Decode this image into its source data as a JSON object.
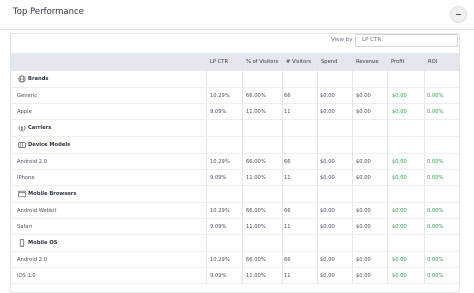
{
  "panel": {
    "title": "Top Performance"
  },
  "view_by": {
    "label": "View by",
    "value": "LP CTR"
  },
  "columns": [
    "LP CTR",
    "% of Visitors",
    "# Visitors",
    "Spend",
    "Revenue",
    "Profit",
    "ROI"
  ],
  "sections": [
    {
      "title": "Brands",
      "icon": "globe-icon",
      "rows": [
        {
          "name": "Generic",
          "cells": [
            "10.29%",
            "66.00%",
            "66",
            "$0.00",
            "$0.00",
            "$0.00",
            "0.00%"
          ]
        },
        {
          "name": "Apple",
          "cells": [
            "9.09%",
            "11.00%",
            "11",
            "$0.00",
            "$0.00",
            "$0.00",
            "0.00%"
          ]
        }
      ]
    },
    {
      "title": "Carriers",
      "icon": "tower-icon",
      "rows": []
    },
    {
      "title": "Device Models",
      "icon": "device-icon",
      "rows": [
        {
          "name": "Android 2.0",
          "cells": [
            "10.29%",
            "66.00%",
            "66",
            "$0.00",
            "$0.00",
            "$0.00",
            "0.00%"
          ]
        },
        {
          "name": "iPhone",
          "cells": [
            "9.09%",
            "11.00%",
            "11",
            "$0.00",
            "$0.00",
            "$0.00",
            "0.00%"
          ]
        }
      ]
    },
    {
      "title": "Mobile Browsers",
      "icon": "browser-icon",
      "rows": [
        {
          "name": "Android Webkit",
          "cells": [
            "10.29%",
            "66.00%",
            "66",
            "$0.00",
            "$0.00",
            "$0.00",
            "0.00%"
          ]
        },
        {
          "name": "Safari",
          "cells": [
            "9.09%",
            "11.00%",
            "11",
            "$0.00",
            "$0.00",
            "$0.00",
            "0.00%"
          ]
        }
      ]
    },
    {
      "title": "Mobile OS",
      "icon": "phone-icon",
      "rows": [
        {
          "name": "Android 2.0",
          "cells": [
            "10.29%",
            "66.00%",
            "66",
            "$0.00",
            "$0.00",
            "$0.00",
            "0.00%"
          ]
        },
        {
          "name": "iOS 1.0",
          "cells": [
            "9.09%",
            "11.00%",
            "11",
            "$0.00",
            "$0.00",
            "$0.00",
            "0.00%"
          ]
        }
      ]
    }
  ],
  "colors": {
    "positive": "#2f9d57",
    "header_bg": "#e4e7ed"
  }
}
